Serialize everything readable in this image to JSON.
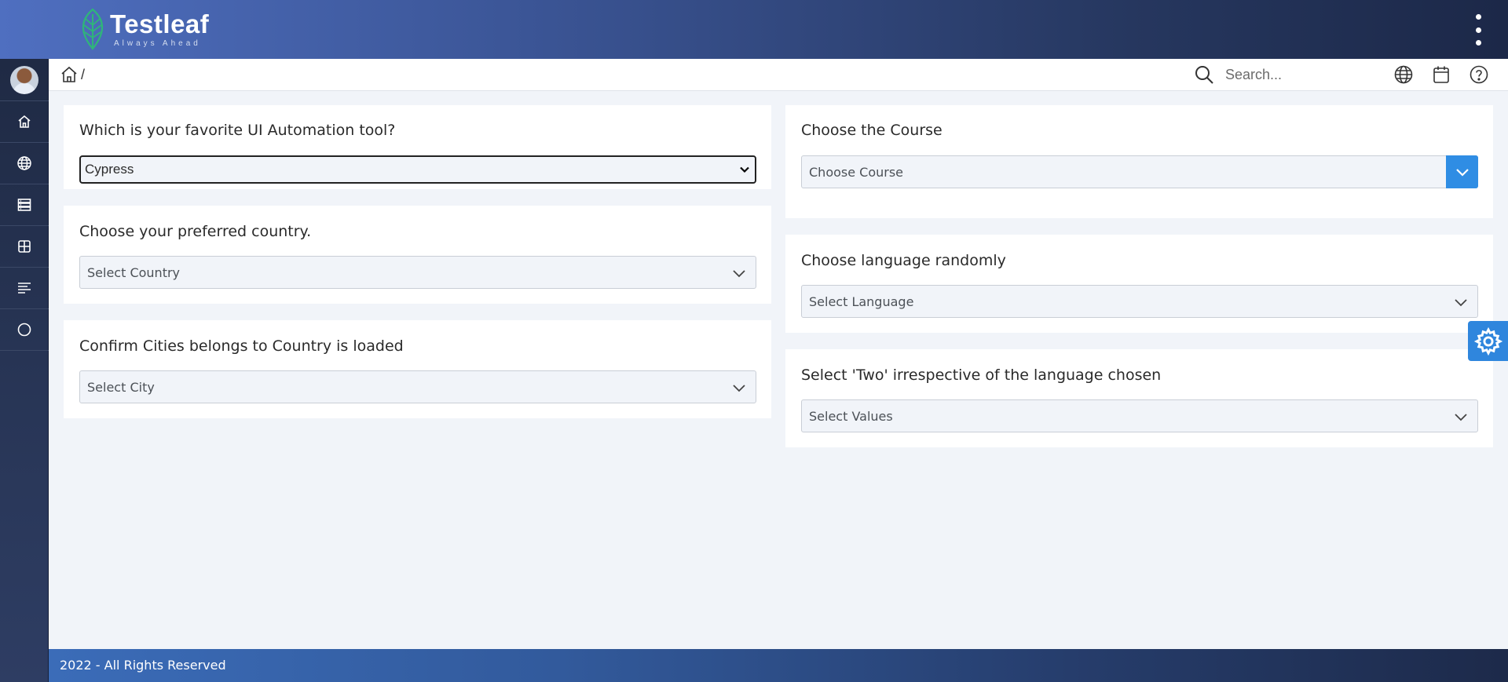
{
  "brand": {
    "name": "Testleaf",
    "tagline": "Always Ahead"
  },
  "header": {
    "breadcrumb_sep": "/",
    "search": {
      "placeholder": "Search...",
      "value": ""
    }
  },
  "sidebar": {
    "items": [
      {
        "icon": "home-icon"
      },
      {
        "icon": "globe-icon"
      },
      {
        "icon": "server-icon"
      },
      {
        "icon": "table-icon"
      },
      {
        "icon": "align-left-icon"
      },
      {
        "icon": "circle-icon"
      }
    ]
  },
  "cards": {
    "ui_tool": {
      "title": "Which is your favorite UI Automation tool?",
      "selected": "Cypress"
    },
    "country": {
      "title": "Choose your preferred country.",
      "placeholder": "Select Country"
    },
    "city": {
      "title": "Confirm Cities belongs to Country is loaded",
      "placeholder": "Select City"
    },
    "course": {
      "title": "Choose the Course",
      "placeholder": "Choose Course"
    },
    "language": {
      "title": "Choose language randomly",
      "placeholder": "Select Language"
    },
    "values": {
      "title": "Select 'Two' irrespective of the language chosen",
      "placeholder": "Select Values"
    }
  },
  "footer": {
    "text": "2022 - All Rights Reserved"
  },
  "colors": {
    "accent": "#2f86dd",
    "leaf": "#2fb57a",
    "page_bg": "#f1f4f9"
  }
}
